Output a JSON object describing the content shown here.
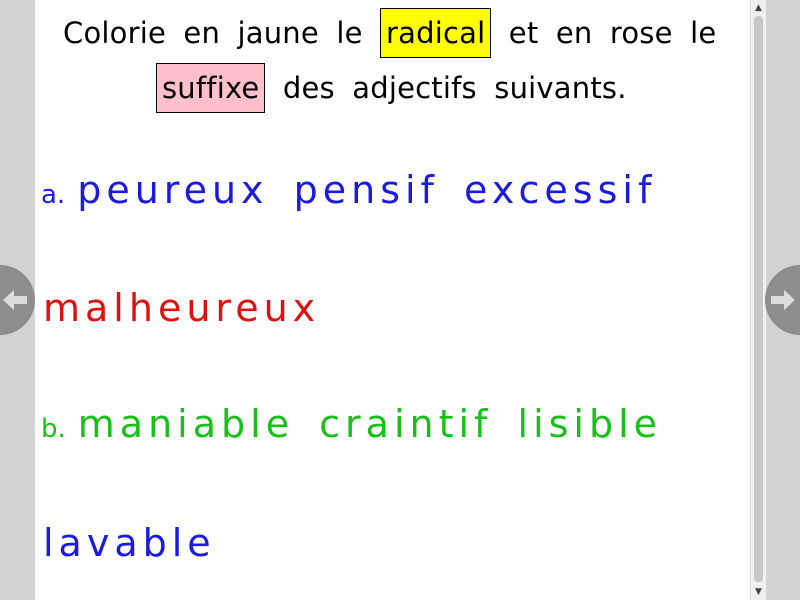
{
  "instruction": {
    "line1_pre": "Colorie en jaune le ",
    "highlight_radical": "radical",
    "line1_post": " et en rose le",
    "highlight_suffixe": "suffixe",
    "line2_post": " des adjectifs suivants."
  },
  "exercises": [
    {
      "prefix": "a.",
      "words_line1": "peureux pensif excessif",
      "words_line2": "malheureux"
    },
    {
      "prefix": "b.",
      "words_line1": "maniable craintif lisible",
      "words_line2": "lavable"
    }
  ],
  "colors": {
    "radical_highlight": "#ffff00",
    "suffixe_highlight": "#ffc0cb",
    "exercise_a_line1": "#1a1ae0",
    "exercise_a_line2": "#e01010",
    "exercise_b_line1": "#17c117",
    "exercise_b_line2": "#1a1ae0",
    "nav_button": "#8d8d8d"
  },
  "navigation": {
    "prev_icon": "arrow-left-icon",
    "next_icon": "arrow-right-icon"
  },
  "scrollbar": {
    "up_glyph": "▲",
    "down_glyph": "▼"
  }
}
